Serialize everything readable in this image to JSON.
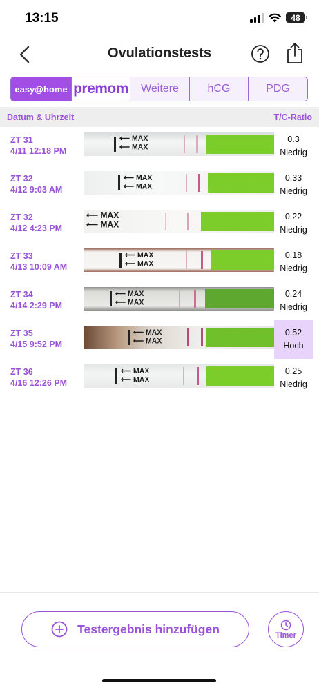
{
  "status_bar": {
    "time": "13:15",
    "battery": "48"
  },
  "nav": {
    "title": "Ovulationstests",
    "back_icon": "chevron-left-icon",
    "help_icon": "question-circle-icon",
    "share_icon": "share-icon"
  },
  "brand_tabs": [
    {
      "label": "easy@home",
      "selected": true
    },
    {
      "label": "premom",
      "selected": false
    },
    {
      "label": "Weitere",
      "selected": false
    },
    {
      "label": "hCG",
      "selected": false
    },
    {
      "label": "PDG",
      "selected": false
    }
  ],
  "table": {
    "col_date": "Datum & Uhrzeit",
    "col_ratio": "T/C-Ratio",
    "rows": [
      {
        "cycle_day": "ZT 31",
        "datetime": "4/11 12:18 PM",
        "ratio": "0.3",
        "level": "Niedrig",
        "high": false
      },
      {
        "cycle_day": "ZT 32",
        "datetime": "4/12 9:03 AM",
        "ratio": "0.33",
        "level": "Niedrig",
        "high": false
      },
      {
        "cycle_day": "ZT 32",
        "datetime": "4/12 4:23 PM",
        "ratio": "0.22",
        "level": "Niedrig",
        "high": false
      },
      {
        "cycle_day": "ZT 33",
        "datetime": "4/13 10:09 AM",
        "ratio": "0.18",
        "level": "Niedrig",
        "high": false
      },
      {
        "cycle_day": "ZT 34",
        "datetime": "4/14 2:29 PM",
        "ratio": "0.24",
        "level": "Niedrig",
        "high": false
      },
      {
        "cycle_day": "ZT 35",
        "datetime": "4/15 9:52 PM",
        "ratio": "0.52",
        "level": "Hoch",
        "high": true
      },
      {
        "cycle_day": "ZT 36",
        "datetime": "4/16 12:26 PM",
        "ratio": "0.25",
        "level": "Niedrig",
        "high": false
      }
    ]
  },
  "strip_text": {
    "max": "MAX"
  },
  "actions": {
    "add_label": "Testergebnis hinzufügen",
    "timer_label": "Timer"
  },
  "colors": {
    "accent": "#9a52d8",
    "brand_tab": "#a24de3",
    "high_bg": "#e8d3fb",
    "strip_green": "#7ccd2a"
  }
}
